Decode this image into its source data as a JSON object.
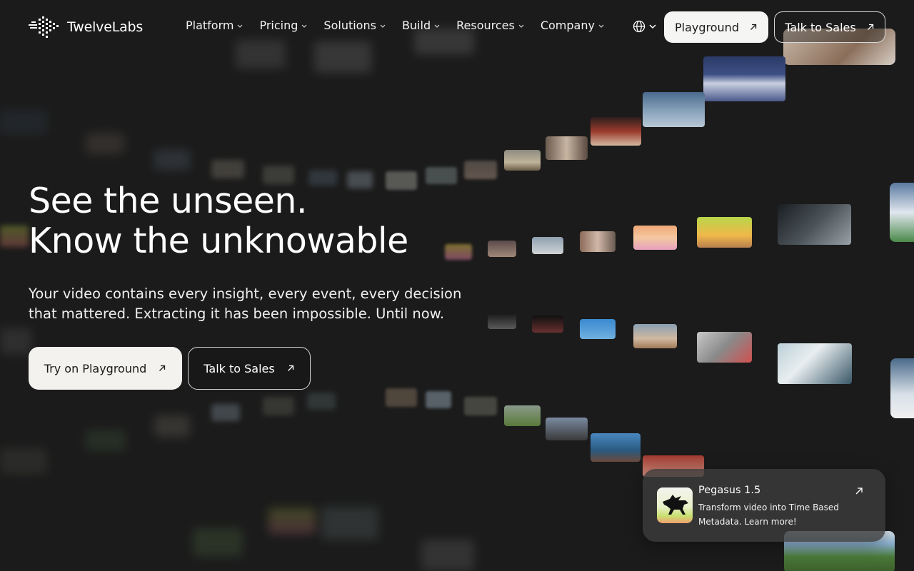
{
  "brand": {
    "name": "TwelveLabs"
  },
  "nav": {
    "items": [
      {
        "label": "Platform"
      },
      {
        "label": "Pricing"
      },
      {
        "label": "Solutions"
      },
      {
        "label": "Build"
      },
      {
        "label": "Resources"
      },
      {
        "label": "Company"
      }
    ],
    "language_icon": "globe-icon",
    "playground_label": "Playground",
    "sales_label": "Talk to Sales"
  },
  "hero": {
    "title_line1": "See the unseen.",
    "title_line2": "Know the unknowable",
    "subtitle": "Your video contains every insight, every event, every decision that mattered. Extracting it has been impossible. Until now.",
    "primary_cta": "Try on Playground",
    "secondary_cta": "Talk to Sales"
  },
  "toast": {
    "title": "Pegasus 1.5",
    "description": "Transform video into Time Based Metadata. Learn more!",
    "icon": "pegasus-icon"
  },
  "colors": {
    "background": "#1b1b1b",
    "button_light": "#f3f2ef",
    "text": "#ffffff"
  }
}
